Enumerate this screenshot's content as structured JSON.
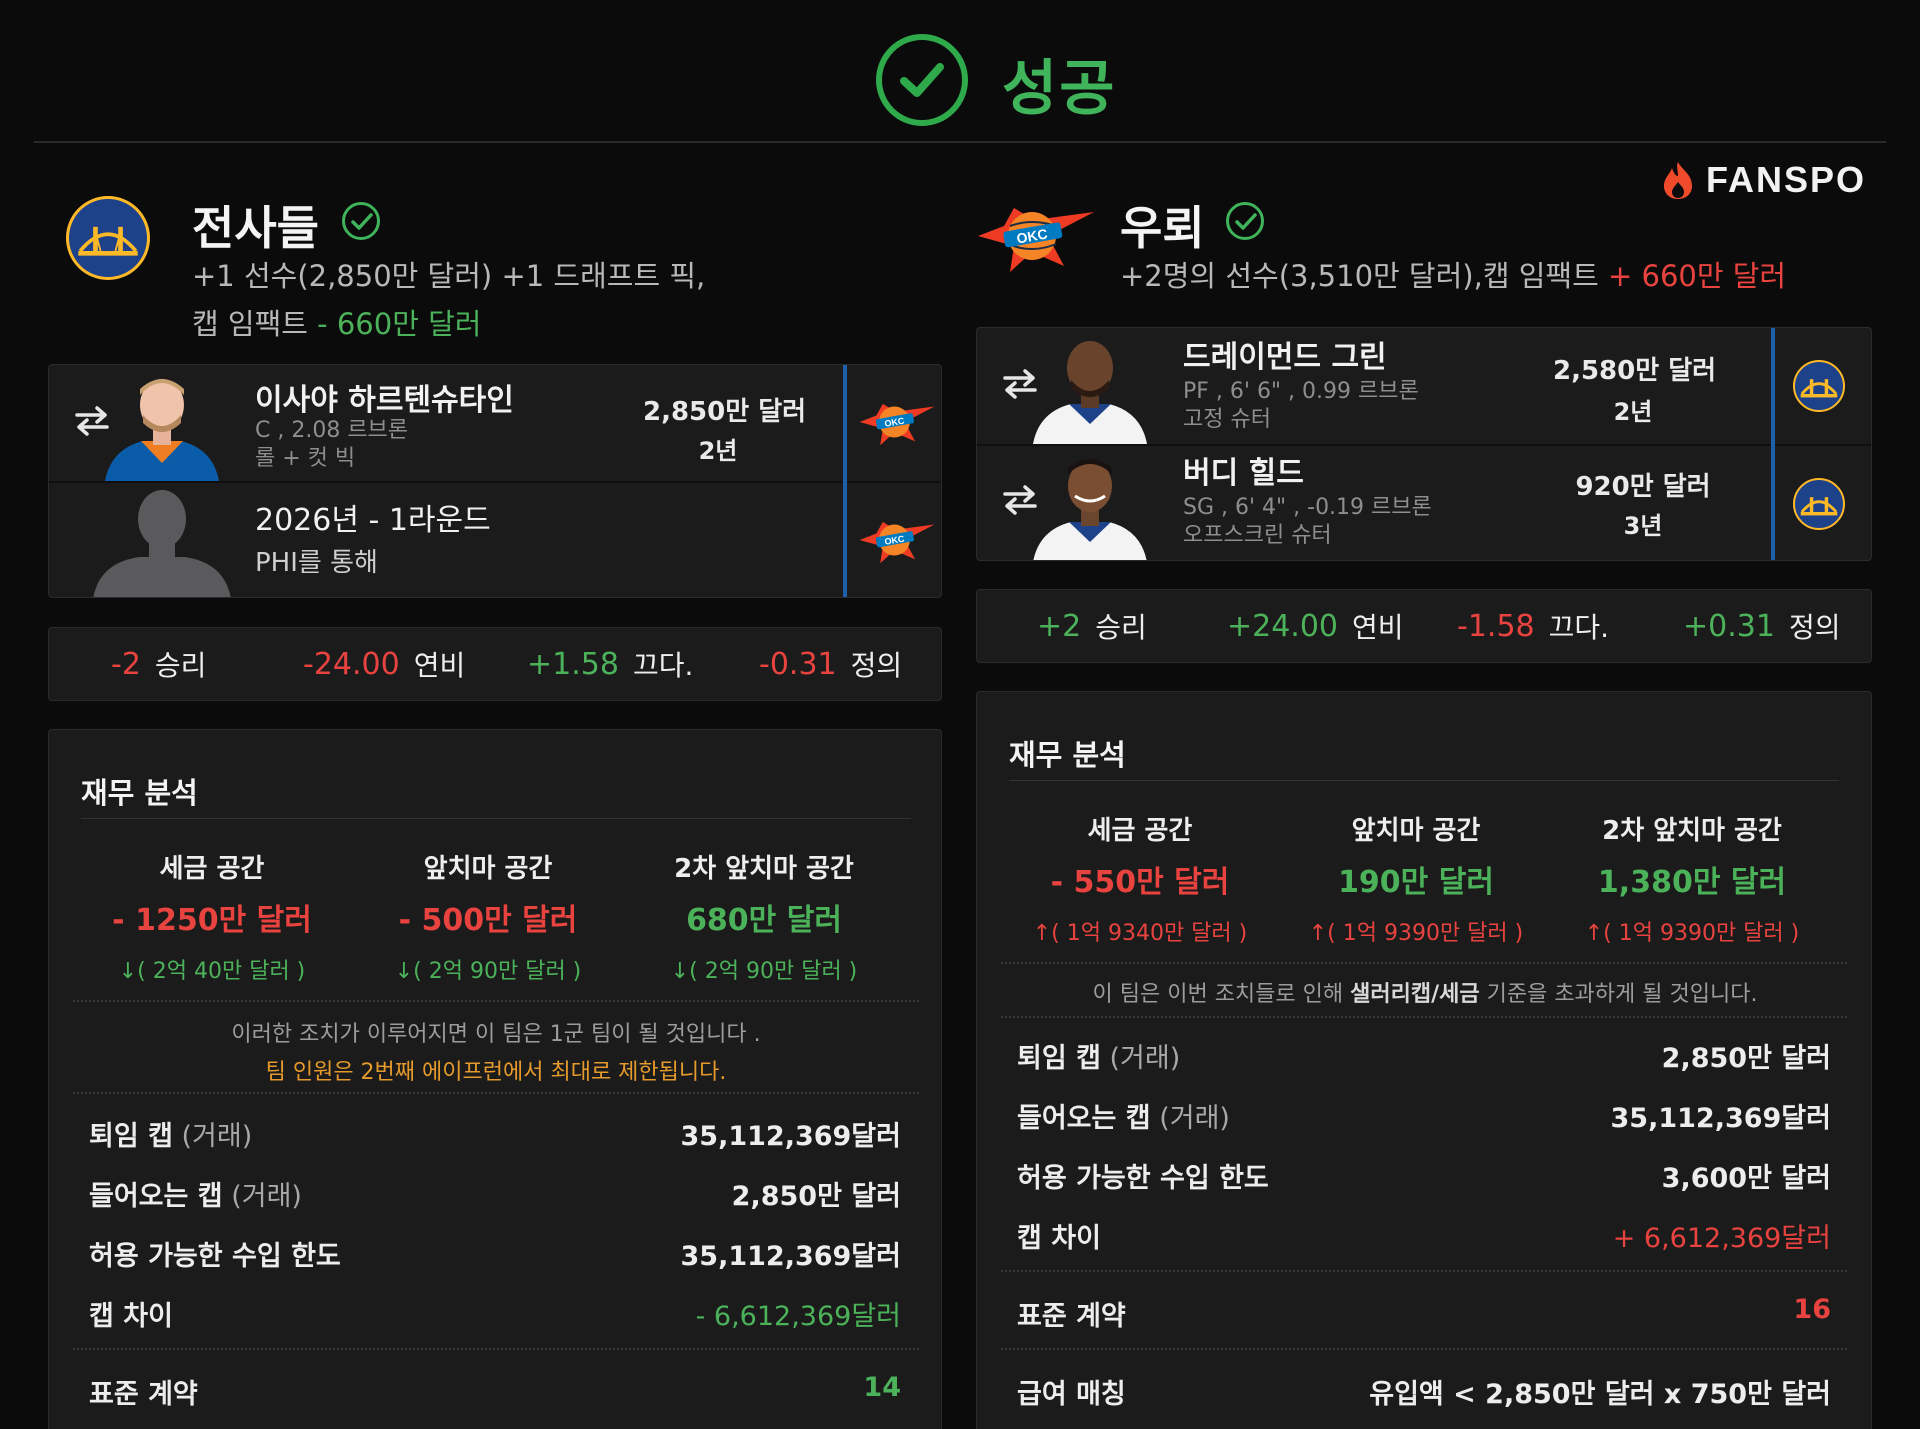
{
  "status": {
    "title": "성공"
  },
  "brand": {
    "name": "FANSPO"
  },
  "left": {
    "team_name": "전사들",
    "summary_line1": "+1 선수(2,850만 달러) +1 드래프트 픽,",
    "summary_line2_prefix": "캡 임팩트",
    "summary_line2_value": " - 660만 달러",
    "players": [
      {
        "name": "이사야 하르텐슈타인",
        "meta1": "C , 2.08 르브론",
        "meta2": "롤 + 컷 빅",
        "salary": "2,850만 달러",
        "years": "2년"
      },
      {
        "name": "2026년 - 1라운드",
        "meta1": "PHI를 통해"
      }
    ],
    "stats": [
      {
        "value": "-2",
        "label": "승리",
        "color": "red"
      },
      {
        "value": "-24.00",
        "label": "연비",
        "color": "red"
      },
      {
        "value": "+1.58",
        "label": "끄다.",
        "color": "green"
      },
      {
        "value": "-0.31",
        "label": "정의",
        "color": "red"
      }
    ],
    "finance": {
      "title": "재무 분석",
      "columns": [
        {
          "head": "세금 공간",
          "value": "- 1250만 달러",
          "value_color": "red",
          "sub": "↓( 2억 40만 달러 )",
          "sub_color": "green"
        },
        {
          "head": "앞치마 공간",
          "value": "- 500만 달러",
          "value_color": "red",
          "sub": "↓( 2억 90만 달러 )",
          "sub_color": "green"
        },
        {
          "head": "2차 앞치마 공간",
          "value": "680만 달러",
          "value_color": "green",
          "sub": "↓( 2억 90만 달러 )",
          "sub_color": "green"
        }
      ],
      "note1": "이러한 조치가 이루어지면 이 팀은 1군 팀이 될 것입니다 .",
      "note2": "팀 인원은 2번째 에이프런에서 최대로 제한됩니다.",
      "rows": [
        {
          "key": "퇴임 캡",
          "key_suffix": " (거래)",
          "value": "35,112,369달러",
          "color": "white"
        },
        {
          "key": "들어오는 캡",
          "key_suffix": " (거래)",
          "value": "2,850만 달러",
          "color": "white"
        },
        {
          "key": "허용 가능한 수입 한도",
          "key_suffix": "",
          "value": "35,112,369달러",
          "color": "white"
        },
        {
          "key": "캡 차이",
          "key_suffix": "",
          "value": "- 6,612,369달러",
          "color": "green"
        },
        {
          "key": "표준 계약",
          "key_suffix": "",
          "value": "14",
          "color": "green"
        }
      ]
    }
  },
  "right": {
    "team_name": "우뢰",
    "summary_prefix": "+2명의 선수(3,510만 달러),캡 임팩트",
    "summary_value": " + 660만 달러",
    "players": [
      {
        "name": "드레이먼드 그린",
        "meta1": "PF , 6' 6\" , 0.99 르브론",
        "meta2": "고정 슈터",
        "salary": "2,580만 달러",
        "years": "2년"
      },
      {
        "name": "버디 힐드",
        "meta1": "SG , 6' 4\" , -0.19 르브론",
        "meta2": "오프스크린 슈터",
        "salary": "920만 달러",
        "years": "3년"
      }
    ],
    "stats": [
      {
        "value": "+2",
        "label": "승리",
        "color": "green"
      },
      {
        "value": "+24.00",
        "label": "연비",
        "color": "green"
      },
      {
        "value": "-1.58",
        "label": "끄다.",
        "color": "red"
      },
      {
        "value": "+0.31",
        "label": "정의",
        "color": "green"
      }
    ],
    "finance": {
      "title": "재무 분석",
      "columns": [
        {
          "head": "세금 공간",
          "value": "- 550만 달러",
          "value_color": "red",
          "sub": "↑( 1억 9340만 달러 )",
          "sub_color": "red"
        },
        {
          "head": "앞치마 공간",
          "value": "190만 달러",
          "value_color": "green",
          "sub": "↑( 1억 9390만 달러 )",
          "sub_color": "red"
        },
        {
          "head": "2차 앞치마 공간",
          "value": "1,380만 달러",
          "value_color": "green",
          "sub": "↑( 1억 9390만 달러 )",
          "sub_color": "red"
        }
      ],
      "note_pre": "이 팀은 이번 조치들로 인해 ",
      "note_bold": "샐러리캡/세금",
      "note_post": " 기준을 초과하게 될 것입니다.",
      "rows": [
        {
          "key": "퇴임 캡",
          "key_suffix": " (거래)",
          "value": "2,850만 달러",
          "color": "white"
        },
        {
          "key": "들어오는 캡",
          "key_suffix": " (거래)",
          "value": "35,112,369달러",
          "color": "white"
        },
        {
          "key": "허용 가능한 수입 한도",
          "key_suffix": "",
          "value": "3,600만 달러",
          "color": "white"
        },
        {
          "key": "캡 차이",
          "key_suffix": "",
          "value": "+ 6,612,369달러",
          "color": "red"
        },
        {
          "key": "표준 계약",
          "key_suffix": "",
          "value": "16",
          "color": "red"
        },
        {
          "key": "급여 매칭",
          "key_suffix": "",
          "value": "유입액 < 2,850만 달러 x 750만 달러",
          "color": "white"
        }
      ]
    }
  },
  "colors": {
    "green": "#4cb25a",
    "red": "#e8433f",
    "orange": "#e59a2b",
    "gsw_blue": "#1d428a",
    "gsw_gold": "#fdb927",
    "okc_blue": "#007ac1",
    "okc_orange": "#ef3b24"
  }
}
